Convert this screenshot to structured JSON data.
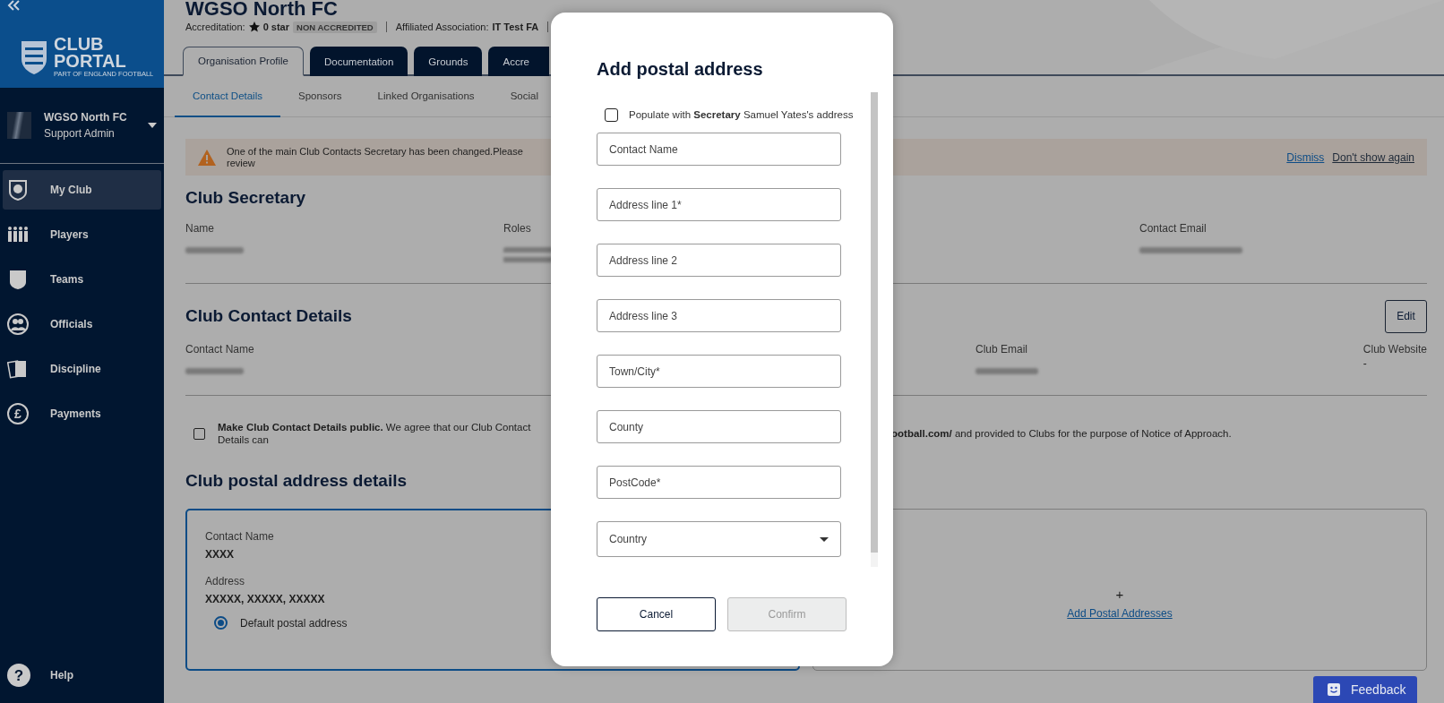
{
  "sidebar": {
    "logo": {
      "line_1": "CLUB",
      "line_2": "PORTAL",
      "tagline": "PART OF ENGLAND FOOTBALL"
    },
    "account": {
      "club": "WGSO North FC",
      "role": "Support Admin"
    },
    "nav": [
      {
        "label": "My Club",
        "kind": "club",
        "selected": true
      },
      {
        "label": "Players",
        "kind": "players",
        "selected": false
      },
      {
        "label": "Teams",
        "kind": "teams",
        "selected": false
      },
      {
        "label": "Officials",
        "kind": "officials",
        "selected": false
      },
      {
        "label": "Discipline",
        "kind": "discipline",
        "selected": false
      },
      {
        "label": "Payments",
        "kind": "payments",
        "selected": false,
        "glyph": "£"
      }
    ],
    "help": {
      "label": "Help",
      "glyph": "?"
    }
  },
  "header": {
    "title": "WGSO North FC",
    "accreditation_label": "Accreditation:",
    "stars_text": "0 star",
    "accreditation_badge": "NON ACCREDITED",
    "association_label": "Affiliated Association:",
    "association": "IT Test FA"
  },
  "tabs": [
    {
      "label": "Organisation Profile",
      "selected": true
    },
    {
      "label": "Documentation",
      "selected": false
    },
    {
      "label": "Grounds",
      "selected": false
    },
    {
      "label": "Accre",
      "selected": false
    }
  ],
  "subtabs": [
    {
      "label": "Contact Details",
      "selected": true
    },
    {
      "label": "Sponsors",
      "selected": false
    },
    {
      "label": "Linked Organisations",
      "selected": false
    },
    {
      "label": "Social",
      "selected": false
    }
  ],
  "alert": {
    "message": "One of the main Club Contacts Secretary has been changed.Please review",
    "actions": [
      {
        "label": "Dismiss",
        "kind": "primary"
      },
      {
        "label": "Don't show again",
        "kind": "secondary"
      }
    ]
  },
  "secretary": {
    "heading": "Club Secretary",
    "fields": [
      {
        "label": "Name",
        "kind": "blurred"
      },
      {
        "label": "Roles",
        "kind": "blurred_multiline"
      },
      {
        "label": "Contact Email",
        "kind": "blurred"
      }
    ]
  },
  "contact": {
    "heading": "Club Contact Details",
    "edit_button": "Edit",
    "fields": [
      {
        "label": "Contact Name",
        "kind": "blurred"
      },
      {
        "label": "Club Email",
        "kind": "blurred"
      },
      {
        "label": "Club Website",
        "kind": "text",
        "value": "-"
      }
    ]
  },
  "public_consent": {
    "checked": false,
    "text_left": "**Make Club Contact Details public.** We agree that our Club Contact Details can",
    "text_right": "**ootball.com/** and provided to Clubs for the purpose of Notice of Approach."
  },
  "postal": {
    "heading": "Club postal address details",
    "addresses": [
      {
        "contact_label": "Contact Name",
        "contact": "XXXX",
        "address_label": "Address",
        "address": "XXXXX, XXXXX, XXXXX",
        "default_label": "Default postal address",
        "selected": true
      }
    ],
    "add": {
      "icon": "+",
      "label": "Add Postal Addresses"
    }
  },
  "modal": {
    "title": "Add postal address",
    "populate": {
      "checked": false,
      "text": "Populate with **Secretary** Samuel Yates's address"
    },
    "fields": [
      {
        "placeholder": "Contact Name",
        "kind": "text"
      },
      {
        "placeholder": "Address line 1*",
        "kind": "text"
      },
      {
        "placeholder": "Address line 2",
        "kind": "text"
      },
      {
        "placeholder": "Address line 3",
        "kind": "text"
      },
      {
        "placeholder": "Town/City*",
        "kind": "text"
      },
      {
        "placeholder": "County",
        "kind": "text"
      },
      {
        "placeholder": "PostCode*",
        "kind": "text"
      },
      {
        "placeholder": "Country",
        "kind": "select"
      }
    ],
    "buttons": [
      {
        "label": "Cancel",
        "kind": "secondary",
        "disabled": false
      },
      {
        "label": "Confirm",
        "kind": "primary",
        "disabled": true
      }
    ]
  },
  "feedback": {
    "label": "Feedback"
  }
}
